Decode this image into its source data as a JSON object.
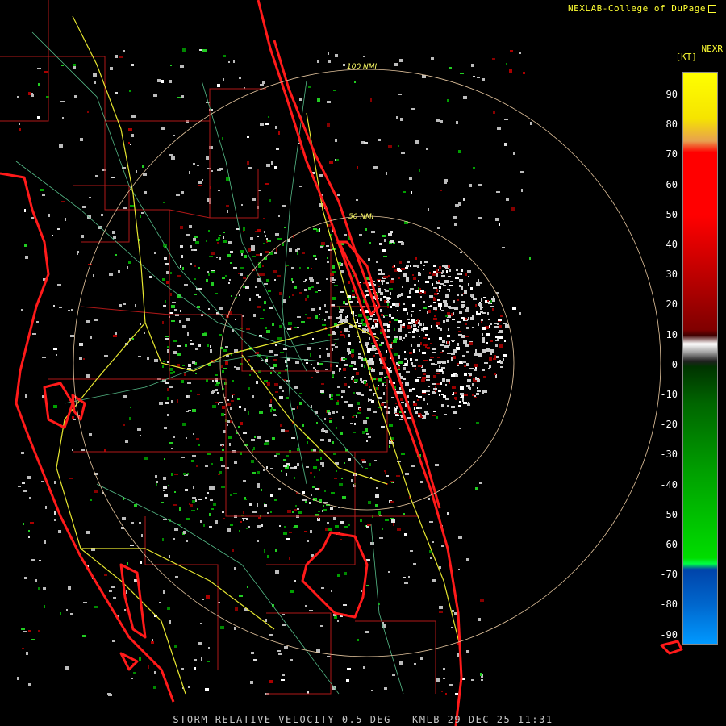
{
  "credit": "NEXLAB-College of DuPage",
  "product_code": "NEXR",
  "units": "[KT]",
  "legend_ticks": [
    "90",
    "80",
    "70",
    "60",
    "50",
    "40",
    "30",
    "20",
    "10",
    "0",
    "-10",
    "-20",
    "-30",
    "-40",
    "-50",
    "-60",
    "-70",
    "-80",
    "-90"
  ],
  "ring_labels": [
    "100 NMI",
    "50 NMI"
  ],
  "footer": "STORM RELATIVE VELOCITY 0.5 DEG - KMLB 29 DEC 25 11:31",
  "colors": {
    "county_lines": "#cc2222",
    "highways": "#ffff44",
    "roads": "#66cc99",
    "coast": "#ff2020",
    "range_rings": "#e8c8a0"
  }
}
